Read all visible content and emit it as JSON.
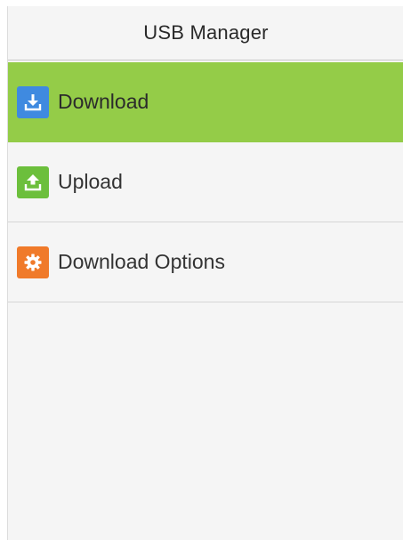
{
  "header": {
    "title": "USB Manager"
  },
  "menu": {
    "items": [
      {
        "label": "Download",
        "icon": "download-icon",
        "icon_color": "#3f8ae0",
        "selected": true
      },
      {
        "label": "Upload",
        "icon": "upload-icon",
        "icon_color": "#6cbf3c",
        "selected": false
      },
      {
        "label": "Download Options",
        "icon": "gear-icon",
        "icon_color": "#f07a2a",
        "selected": false
      }
    ]
  },
  "colors": {
    "selected_background": "#94cc48",
    "screen_background": "#f5f5f5"
  }
}
